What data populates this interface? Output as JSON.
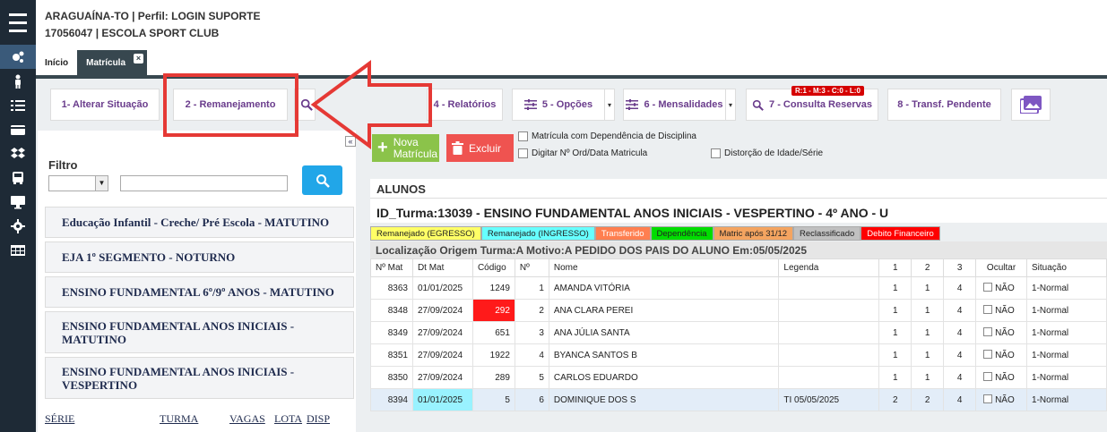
{
  "header": {
    "line1": "ARAGUAÍNA-TO | Perfil: LOGIN SUPORTE",
    "line2": "17056047 | ESCOLA SPORT CLUB"
  },
  "rail": [
    "menu-icon",
    "settings-cog-icon",
    "user-icon",
    "list-icon",
    "card-icon",
    "dropbox-icon",
    "bus-icon",
    "monitor-icon",
    "gear-icon",
    "table-icon"
  ],
  "tabs": {
    "inicio": "Início",
    "matricula": "Matrícula",
    "close": "×"
  },
  "toolbar": {
    "alterar": "1- Alterar Situação",
    "remanejamento": "2 - Remanejamento",
    "relatorios": "4 - Relatórios",
    "opcoes": "5 - Opções",
    "mensalidades": "6 - Mensalidades",
    "consulta": "7 - Consulta Reservas",
    "consulta_badge": "R:1 - M:3 - C:0 - L:0",
    "transf": "8 - Transf. Pendente",
    "caret": "▾"
  },
  "filtro": {
    "label": "Filtro"
  },
  "turnos": [
    "Educação Infantil - Creche/ Pré Escola - MATUTINO",
    "EJA 1º SEGMENTO - NOTURNO",
    "ENSINO FUNDAMENTAL 6º/9º ANOS - MATUTINO",
    "ENSINO FUNDAMENTAL ANOS INICIAIS - MATUTINO",
    "ENSINO FUNDAMENTAL ANOS INICIAIS - VESPERTINO"
  ],
  "turma_head": [
    "SÉRIE",
    "TURMA",
    "VAGAS",
    "LOTA",
    "DISP"
  ],
  "actions": {
    "nova": "Nova Matrícula",
    "excluir": "Excluir",
    "chk_dependencia": "Matrícula com Dependência de Disciplina",
    "chk_digitar": "Digitar Nº Ord/Data Matricula",
    "chk_distorcao": "Distorção de Idade/Série"
  },
  "alunos": {
    "title": "ALUNOS",
    "turma": "ID_Turma:13039 - ENSINO FUNDAMENTAL ANOS INICIAIS - VESPERTINO - 4º ANO - U",
    "motivo": "Localização Origem Turma:A Motivo:A PEDIDO DOS PAIS DO ALUNO Em:05/05/2025"
  },
  "legend": [
    {
      "label": "Remanejado (EGRESSO)",
      "bg": "#ffff66",
      "fg": "#222222"
    },
    {
      "label": "Remanejado (INGRESSO)",
      "bg": "#66ffff",
      "fg": "#222222"
    },
    {
      "label": "Transferido",
      "bg": "#ff7f50",
      "fg": "#ffffff"
    },
    {
      "label": "Dependência",
      "bg": "#00dd00",
      "fg": "#222222"
    },
    {
      "label": "Matric após 31/12",
      "bg": "#f4a460",
      "fg": "#222222"
    },
    {
      "label": "Reclassificado",
      "bg": "#c0c0c0",
      "fg": "#222222"
    },
    {
      "label": "Debito Financeiro",
      "bg": "#ff0000",
      "fg": "#ffffff"
    }
  ],
  "table": {
    "headers": [
      "Nº Mat",
      "Dt Mat",
      "Código",
      "Nº",
      "Nome",
      "Legenda",
      "1",
      "2",
      "3",
      "Ocultar",
      "Situação"
    ],
    "rows": [
      [
        "8363",
        "01/01/2025",
        "1249",
        "1",
        "AMANDA VITÓRIA",
        "",
        "1",
        "1",
        "4",
        "NÃO",
        "1-Normal"
      ],
      [
        "8348",
        "27/09/2024",
        "292",
        "2",
        "ANA CLARA PEREI",
        "",
        "1",
        "1",
        "4",
        "NÃO",
        "1-Normal"
      ],
      [
        "8349",
        "27/09/2024",
        "651",
        "3",
        "ANA JÚLIA SANTA",
        "",
        "1",
        "1",
        "4",
        "NÃO",
        "1-Normal"
      ],
      [
        "8351",
        "27/09/2024",
        "1922",
        "4",
        "BYANCA SANTOS B",
        "",
        "1",
        "1",
        "4",
        "NÃO",
        "1-Normal"
      ],
      [
        "8350",
        "27/09/2024",
        "289",
        "5",
        "CARLOS EDUARDO",
        "",
        "1",
        "1",
        "4",
        "NÃO",
        "1-Normal"
      ],
      [
        "8394",
        "01/01/2025",
        "5",
        "6",
        "DOMINIQUE DOS S",
        "TI 05/05/2025",
        "2",
        "2",
        "4",
        "NÃO",
        "1-Normal"
      ]
    ]
  },
  "annotation": {
    "color": "#e53935"
  }
}
